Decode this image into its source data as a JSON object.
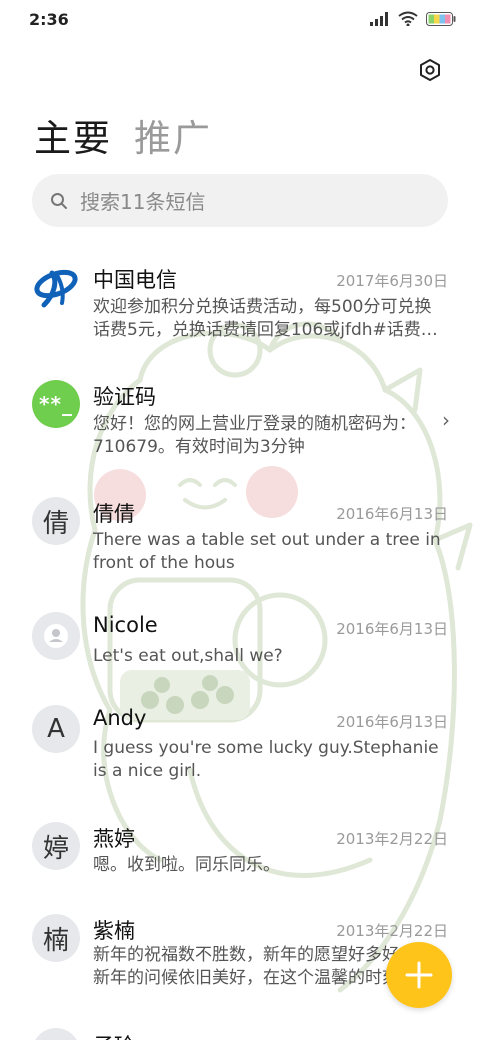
{
  "status_bar": {
    "time": "2:36"
  },
  "tabs": [
    {
      "label": "主要",
      "active": true
    },
    {
      "label": "推广",
      "active": false
    }
  ],
  "search": {
    "placeholder": "搜索11条短信"
  },
  "conversations": [
    {
      "avatar": "",
      "avatar_icon": "china-telecom-logo-icon",
      "name": "中国电信",
      "date": "2017年6月30日",
      "snippet": "欢迎参加积分兑换话费活动，每500分可兑换话费5元，兑换话费请回复106或jfdh#话费…"
    },
    {
      "avatar": "**_",
      "name": "验证码",
      "date": "",
      "snippet": "您好！您的网上营业厅登录的随机密码为：710679。有效时间为3分钟",
      "has_chevron": true
    },
    {
      "avatar": "倩",
      "name": "倩倩",
      "date": "2016年6月13日",
      "snippet": "There was a table set out under a tree in front of the hous"
    },
    {
      "avatar": "",
      "avatar_icon": "person-icon",
      "name": "Nicole",
      "date": "2016年6月13日",
      "snippet": "Let's eat out,shall we?"
    },
    {
      "avatar": "A",
      "name": "Andy",
      "date": "2016年6月13日",
      "snippet": "I guess you're some lucky guy.Stephanie is a nice girl."
    },
    {
      "avatar": "婷",
      "name": "燕婷",
      "date": "2013年2月22日",
      "snippet": "嗯。收到啦。同乐同乐。"
    },
    {
      "avatar": "楠",
      "name": "紫楠",
      "date": "2013年2月22日",
      "snippet": "新年的祝福数不胜数，新年的愿望好多好多，新年的问候依旧美好，在这个温馨的时刻"
    },
    {
      "avatar": "",
      "name": "子玲",
      "date": "",
      "snippet": ""
    }
  ],
  "colors": {
    "fab": "#ffc41a",
    "verification_avatar": "#6fce4d",
    "telecom_blue": "#1062b8"
  }
}
